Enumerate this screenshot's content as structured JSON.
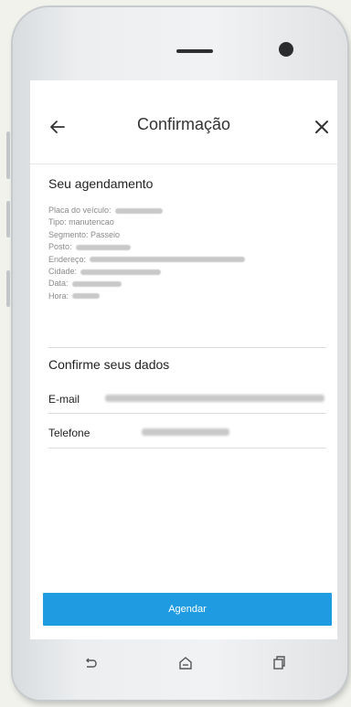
{
  "header": {
    "title": "Confirmação"
  },
  "appointment": {
    "section_title": "Seu agendamento",
    "fields": [
      {
        "label": "Placa do veículo:",
        "value": ""
      },
      {
        "label": "Tipo: manutencao",
        "value": ""
      },
      {
        "label": "Segmento: Passeio",
        "value": ""
      },
      {
        "label": "Posto:",
        "value": ""
      },
      {
        "label": "Endereço:",
        "value": ""
      },
      {
        "label": "Cidade:",
        "value": ""
      },
      {
        "label": "Data:",
        "value": ""
      },
      {
        "label": "Hora:",
        "value": ""
      }
    ]
  },
  "confirm": {
    "section_title": "Confirme seus dados",
    "email_label": "E-mail",
    "email_value": "",
    "phone_label": "Telefone",
    "phone_value": ""
  },
  "actions": {
    "schedule_label": "Agendar"
  },
  "icons": {
    "back": "arrow-left-icon",
    "close": "close-icon",
    "nav_back": "nav-back-icon",
    "nav_home": "nav-home-icon",
    "nav_recents": "nav-recents-icon"
  },
  "colors": {
    "accent": "#1f9be1",
    "background": "#ffffff"
  }
}
